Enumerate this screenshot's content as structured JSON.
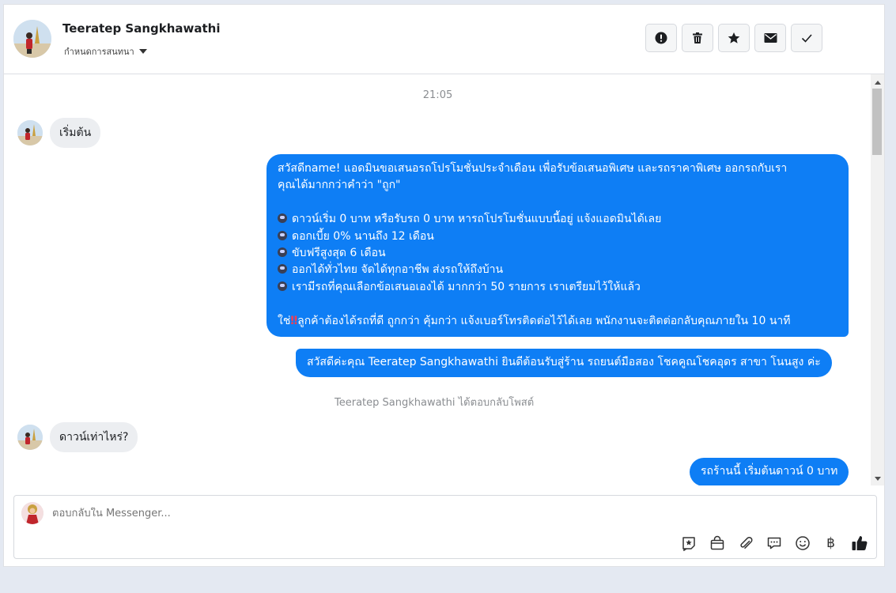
{
  "header": {
    "contact_name": "Teeratep Sangkhawathi",
    "assign_label": "กำหนดการสนทนา",
    "actions": [
      "alert-icon",
      "trash-icon",
      "star-icon",
      "mail-icon",
      "check-icon"
    ]
  },
  "thread": {
    "timestamp": "21:05",
    "incoming_1": "เริ่มต้น",
    "outgoing_1": {
      "line1": "สวัสดีname! แอดมินขอเสนอรถโปรโมชั่นประจำเดือน เพื่อรับข้อเสนอพิเศษ และรถราคาพิเศษ ออกรถกับเรา",
      "line2": "คุณได้มากกว่าคำว่า \"ถูก\"",
      "bullets": [
        "ดาวน์เริ่ม 0 บาท หรือรับรถ 0 บาท หารถโปรโมชั่นแบบนี้อยู่ แจ้งแอดมินได้เลย",
        "ดอกเบี้ย 0% นานถึง 12 เดือน",
        "ขับฟรีสูงสุด 6 เดือน",
        "ออกได้ทั่วไทย จัดได้ทุกอาชีพ ส่งรถให้ถึงบ้าน",
        "เรามีรถที่คุณเลือกข้อเสนอเองได้ มากกว่า 50 รายการ เราเตรียมไว้ให้แล้ว"
      ],
      "closing_prefix": "ใช่",
      "closing_mark": "‼",
      "closing_text": "ลูกค้าต้องได้รถที่ดี ถูกกว่า คุ้มกว่า แจ้งเบอร์โทรติดต่อไว้ได้เลย พนักงานจะติดต่อกลับคุณภายใน 10 นาที"
    },
    "outgoing_2": "สวัสดีค่ะคุณ Teeratep Sangkhawathi ยินดีต้อนรับสู่ร้าน รถยนต์มือสอง โชคคูณโชคอุดร สาขา โนนสูง ค่ะ",
    "system_note": "Teeratep Sangkhawathi ได้ตอบกลับโพสต์",
    "incoming_2": "ดาวน์เท่าไหร่?",
    "outgoing_3": "รถร้านนี้ เริ่มต้นดาวน์ 0 บาท"
  },
  "composer": {
    "placeholder": "ตอบกลับใน Messenger...",
    "tools": [
      "sticker-icon",
      "bag-icon",
      "attachment-icon",
      "saved-reply-icon",
      "emoji-icon",
      "baht-icon",
      "like-icon"
    ],
    "baht_symbol": "฿"
  },
  "colors": {
    "accent": "#0e7ef5",
    "bubble_in": "#eceef1",
    "background": "#e4e9f2"
  }
}
